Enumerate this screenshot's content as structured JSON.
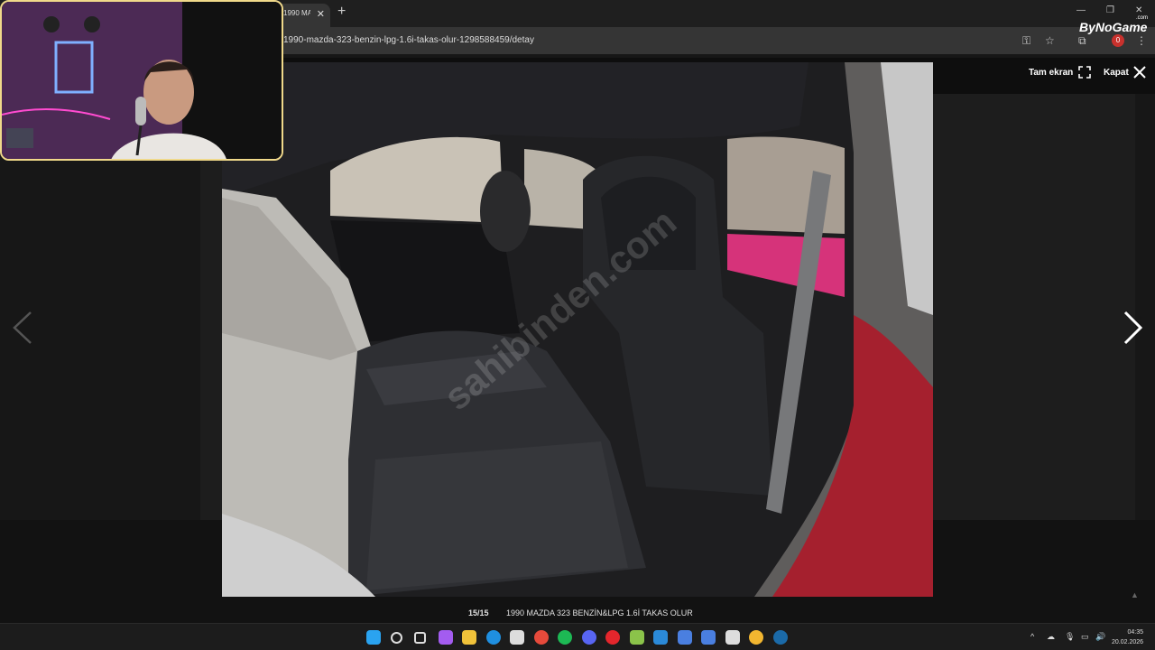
{
  "browser": {
    "tab_title": "1990 MA",
    "url": "1990-mazda-323-benzin-lpg-1.6i-takas-olur-1298588459/detay",
    "extension_badge": "0",
    "brand": "ByNoGame",
    "brand_sub": ".com"
  },
  "gallery": {
    "fullscreen_label": "Tam ekran",
    "close_label": "Kapat",
    "counter": "15/15",
    "title": "1990 MAZDA 323 BENZİN&LPG 1.6İ TAKAS OLUR",
    "watermark": "sahibinden.com"
  },
  "taskbar": {
    "time": "04:35",
    "date": "20.02.2026",
    "icons": [
      "windows-start-icon",
      "search-icon",
      "task-view-icon",
      "copilot-icon",
      "file-explorer-icon",
      "edge-icon",
      "store-icon",
      "chrome-icon",
      "spotify-icon",
      "discord-icon",
      "opera-icon",
      "app-icon",
      "vscode-icon",
      "app-icon",
      "app-icon",
      "obs-icon",
      "chrome-icon",
      "steam-icon"
    ],
    "icon_colors": [
      "#2aa3f0",
      "#dddddd",
      "#dddddd",
      "#a35cf0",
      "#f0c23a",
      "#1f8fe0",
      "#dddddd",
      "#e64a3b",
      "#1db954",
      "#5865f2",
      "#e4262c",
      "#8bc34a",
      "#2b8ad8",
      "#4a7fe0",
      "#4a7fe0",
      "#dddddd",
      "#f2b630",
      "#1b6aa8"
    ]
  }
}
